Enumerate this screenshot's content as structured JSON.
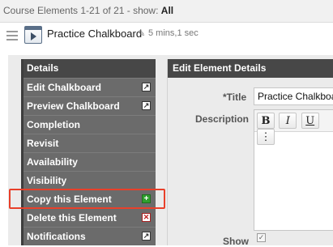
{
  "topbar": {
    "prefix": "Course Elements 1-21 of 21 - show:",
    "show_value": "All"
  },
  "element": {
    "title": "Practice Chalkboard",
    "duration": "5 mins,1 sec",
    "icon": "video-icon"
  },
  "sidebar": {
    "header": "Details",
    "items": [
      {
        "label": "Edit Chalkboard",
        "icon": "external-link-icon"
      },
      {
        "label": "Preview Chalkboard",
        "icon": "external-link-icon"
      },
      {
        "label": "Completion"
      },
      {
        "label": "Revisit"
      },
      {
        "label": "Availability"
      },
      {
        "label": "Visibility"
      },
      {
        "label": "Copy this Element",
        "icon": "add-icon"
      },
      {
        "label": "Delete this Element",
        "icon": "delete-icon"
      },
      {
        "label": "Notifications",
        "icon": "external-link-icon"
      }
    ]
  },
  "main": {
    "header": "Edit Element Details",
    "title_label": "*Title",
    "title_value": "Practice Chalkboard",
    "description_label": "Description",
    "toolbar": {
      "bold": "B",
      "italic": "I",
      "underline": "U",
      "more": "⋮"
    },
    "show_label": "Show",
    "show_checked": true
  },
  "highlight": {
    "target": "Copy this Element",
    "color": "#e8402a"
  }
}
